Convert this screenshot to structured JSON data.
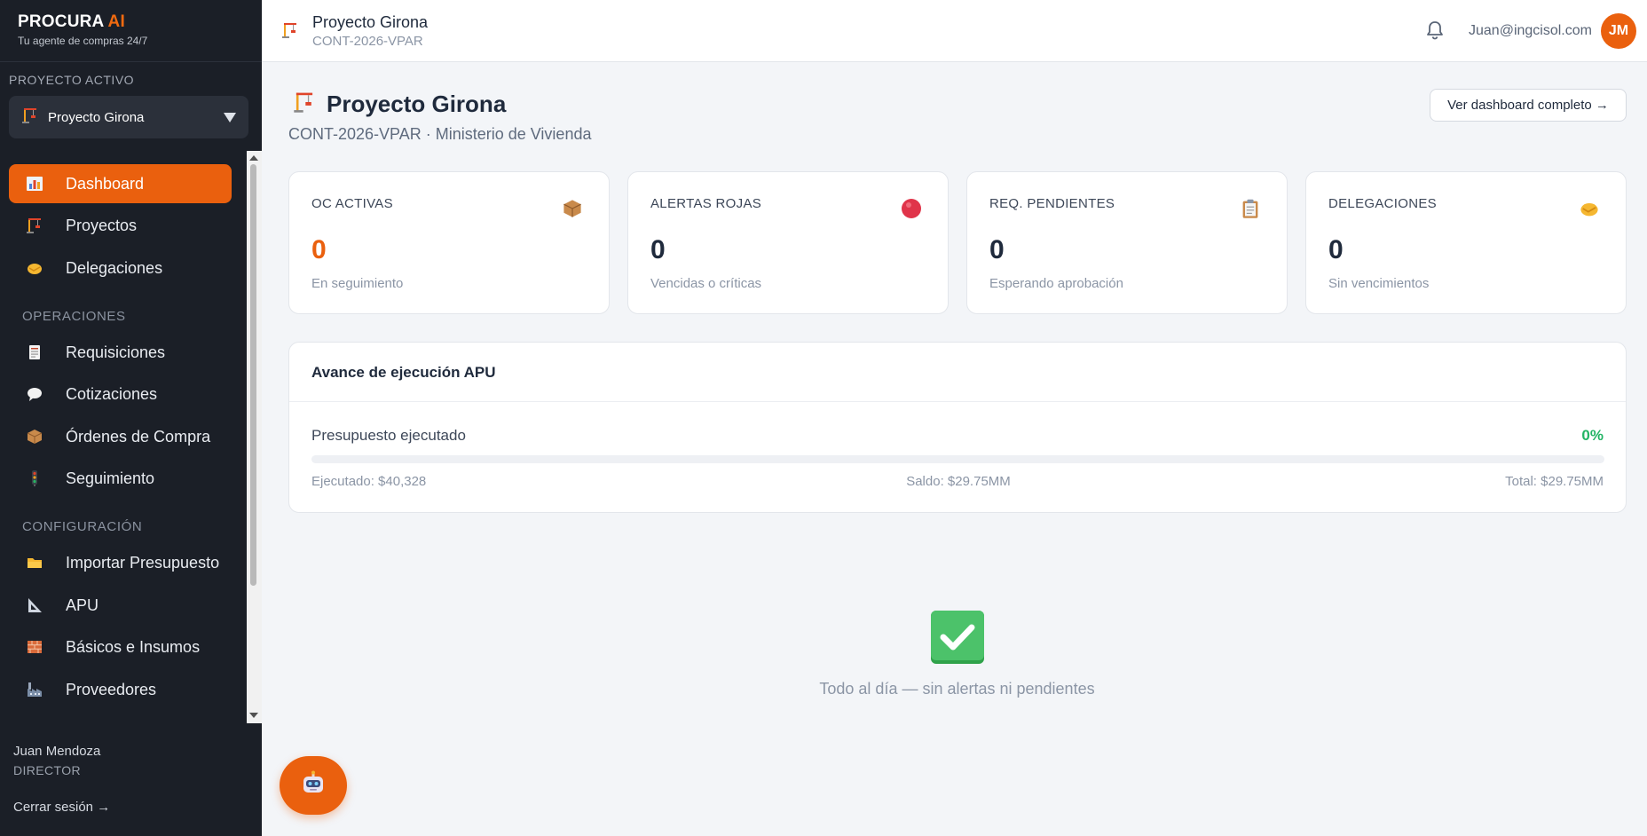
{
  "brand": {
    "name": "PROCURA",
    "name_accent": "AI",
    "tagline": "Tu agente de compras 24/7"
  },
  "sidebar": {
    "active_project_label": "PROYECTO ACTIVO",
    "active_project": "Proyecto Girona",
    "items": [
      {
        "label": "Dashboard",
        "icon": "bar-chart-icon",
        "active": true
      },
      {
        "label": "Proyectos",
        "icon": "crane-icon"
      },
      {
        "label": "Delegaciones",
        "icon": "handshake-icon"
      }
    ],
    "section_operaciones": "OPERACIONES",
    "operaciones": [
      {
        "label": "Requisiciones",
        "icon": "receipt-icon"
      },
      {
        "label": "Cotizaciones",
        "icon": "speech-bubble-icon"
      },
      {
        "label": "Órdenes de Compra",
        "icon": "package-icon"
      },
      {
        "label": "Seguimiento",
        "icon": "traffic-light-icon"
      }
    ],
    "section_configuracion": "CONFIGURACIÓN",
    "configuracion": [
      {
        "label": "Importar Presupuesto",
        "icon": "folder-icon"
      },
      {
        "label": "APU",
        "icon": "triangle-ruler-icon"
      },
      {
        "label": "Básicos e Insumos",
        "icon": "bricks-icon"
      },
      {
        "label": "Proveedores",
        "icon": "factory-icon"
      }
    ],
    "user_name": "Juan Mendoza",
    "user_role": "DIRECTOR",
    "logout": "Cerrar sesión →"
  },
  "topbar": {
    "project_title": "Proyecto Girona",
    "project_code": "CONT-2026-VPAR",
    "email": "Juan@ingcisol.com",
    "avatar_initials": "JM"
  },
  "main": {
    "title": "Proyecto Girona",
    "subtitle": "CONT-2026-VPAR · Ministerio de Vivienda",
    "dashboard_button": "Ver dashboard completo →",
    "cards": [
      {
        "label": "OC ACTIVAS",
        "value": "0",
        "sub": "En seguimiento",
        "icon": "package-icon"
      },
      {
        "label": "ALERTAS ROJAS",
        "value": "0",
        "sub": "Vencidas o críticas",
        "icon": "red-circle-icon"
      },
      {
        "label": "REQ. PENDIENTES",
        "value": "0",
        "sub": "Esperando aprobación",
        "icon": "clipboard-icon"
      },
      {
        "label": "DELEGACIONES",
        "value": "0",
        "sub": "Sin vencimientos",
        "icon": "handshake-icon"
      }
    ],
    "apu": {
      "title": "Avance de ejecución APU",
      "label": "Presupuesto ejecutado",
      "percent_text": "0%",
      "progress": 0,
      "executed": "Ejecutado: $40,328",
      "balance": "Saldo: $29.75MM",
      "total": "Total: $29.75MM"
    },
    "empty_state": "Todo al día — sin alertas ni pendientes"
  },
  "colors": {
    "accent": "#ea600e",
    "sidebar_bg": "#1b1f27",
    "success": "#22b464"
  }
}
